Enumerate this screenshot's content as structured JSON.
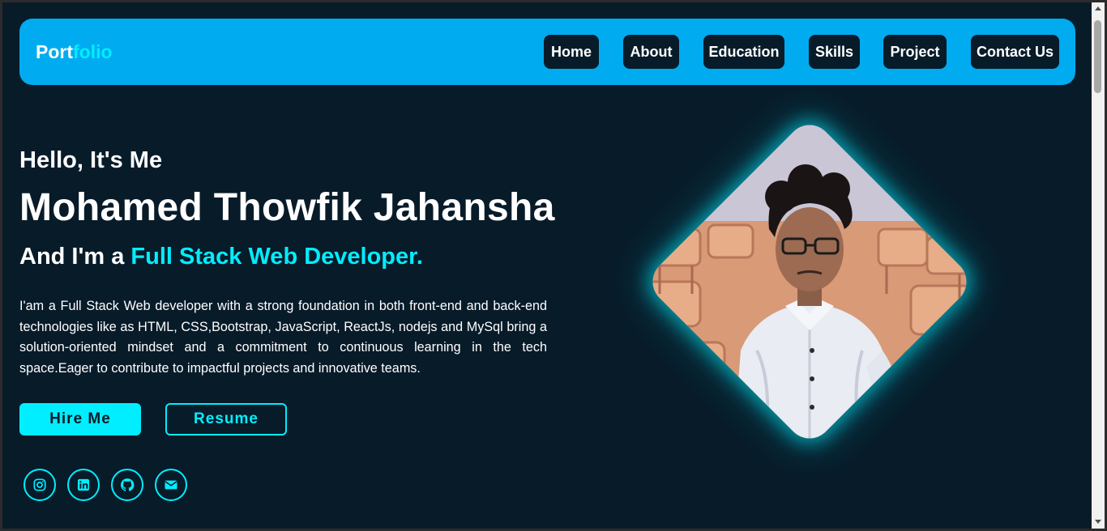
{
  "navbar": {
    "logo_main": "Port",
    "logo_accent": "folio",
    "links": [
      "Home",
      "About",
      "Education",
      "Skills",
      "Project",
      "Contact Us"
    ]
  },
  "hero": {
    "greeting": "Hello, It's Me",
    "name": "Mohamed Thowfik Jahansha",
    "role_prefix": "And I'm a ",
    "role_accent": "Full Stack Web Developer.",
    "bio": "I'am a Full Stack Web developer with a strong foundation in both front-end and back-end technologies like as HTML, CSS,Bootstrap, JavaScript, ReactJs, nodejs and MySql bring a solution-oriented mindset and a commitment to continuous learning in the tech space.Eager to contribute to impactful projects and innovative teams.",
    "hire_label": "Hire Me",
    "resume_label": "Resume"
  },
  "social": [
    "instagram-icon",
    "linkedin-icon",
    "github-icon",
    "envelope-icon"
  ],
  "colors": {
    "background": "#081b29",
    "navbar": "#00abf0",
    "accent": "#00eeff",
    "text": "#ffffff"
  }
}
